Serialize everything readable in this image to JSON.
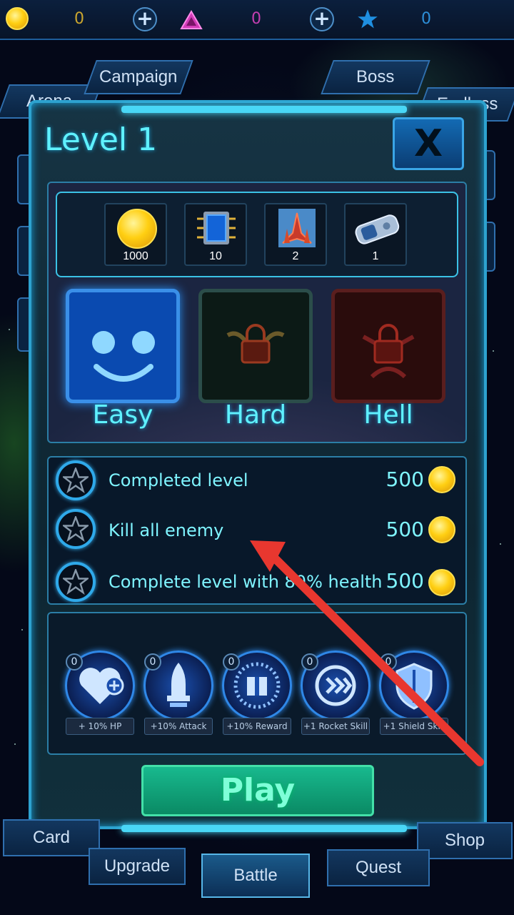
{
  "currency": {
    "gold": {
      "value": "0",
      "icon": "gold-coin-icon"
    },
    "gems": {
      "value": "0",
      "icon": "pink-crystal-icon"
    },
    "stars": {
      "value": "0",
      "icon": "blue-star-icon"
    }
  },
  "modes": {
    "campaign": "Campaign",
    "boss": "Boss",
    "arena": "Arena",
    "endless": "Endless"
  },
  "panel": {
    "title": "Level 1",
    "close_label": "X",
    "rewards": [
      {
        "icon": "gold-coin-icon",
        "count": "1000"
      },
      {
        "icon": "chip-icon",
        "count": "10"
      },
      {
        "icon": "spaceship-fragment-icon",
        "count": "2"
      },
      {
        "icon": "ammo-canister-icon",
        "count": "1"
      }
    ],
    "difficulties": [
      {
        "label": "Easy",
        "locked": false,
        "icon": "smiley-face-icon"
      },
      {
        "label": "Hard",
        "locked": true,
        "icon": "lock-icon"
      },
      {
        "label": "Hell",
        "locked": true,
        "icon": "lock-icon"
      }
    ],
    "objectives": [
      {
        "text": "Completed level",
        "reward": "500"
      },
      {
        "text": "Kill all enemy",
        "reward": "500"
      },
      {
        "text": "Complete level with 80% health",
        "reward": "500"
      }
    ],
    "boosts": [
      {
        "count": "0",
        "label": "+ 10% HP",
        "icon": "heart-plus-icon"
      },
      {
        "count": "0",
        "label": "+10% Attack",
        "icon": "rocket-icon"
      },
      {
        "count": "0",
        "label": "+10% Reward",
        "icon": "gift-box-icon"
      },
      {
        "count": "0",
        "label": "+1 Rocket Skill",
        "icon": "fast-forward-icon"
      },
      {
        "count": "0",
        "label": "+1 Shield Skill",
        "icon": "shield-armor-icon"
      }
    ],
    "play_label": "Play"
  },
  "nav": {
    "card": "Card",
    "shop": "Shop",
    "upgrade": "Upgrade",
    "battle": "Battle",
    "quest": "Quest"
  },
  "colors": {
    "accent": "#5ff1ff",
    "panel_border": "#2da2cf",
    "play": "#18b98e",
    "arrow": "#e8372f"
  }
}
